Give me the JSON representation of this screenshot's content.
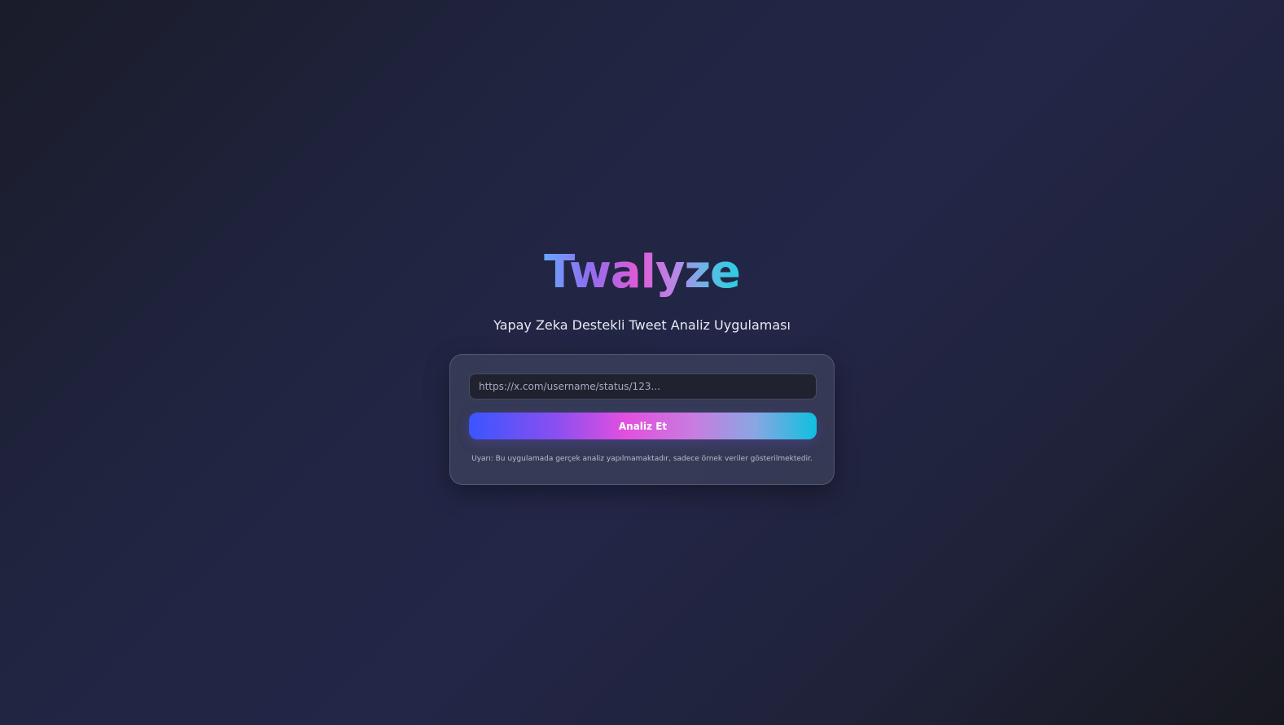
{
  "app": {
    "logo_text": "Twalyze",
    "subtitle": "Yapay Zeka Destekli Tweet Analiz Uygulaması"
  },
  "form": {
    "url_placeholder": "https://x.com/username/status/123...",
    "url_value": "",
    "analyze_label": "Analiz Et",
    "warning": "Uyarı: Bu uygulamada gerçek analiz yapılmamaktadır, sadece örnek veriler gösterilmektedir."
  },
  "colors": {
    "accent_start": "#3a55ff",
    "accent_mid": "#e24fdf",
    "accent_end": "#0fc0df",
    "background": "#212542"
  }
}
